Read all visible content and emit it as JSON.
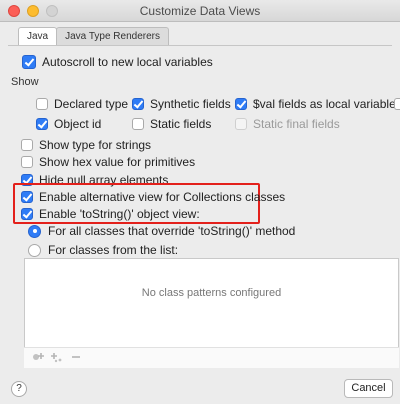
{
  "window": {
    "title": "Customize Data Views"
  },
  "tabs": [
    {
      "label": "Java",
      "active": true
    },
    {
      "label": "Java Type Renderers",
      "active": false
    }
  ],
  "autoscroll": {
    "label": "Autoscroll to new local variables",
    "checked": true
  },
  "show_section": {
    "label": "Show",
    "options": [
      {
        "label": "Declared type",
        "checked": false
      },
      {
        "label": "Synthetic fields",
        "checked": true
      },
      {
        "label": "$val fields as local variables",
        "checked": true
      },
      {
        "label": "Object id",
        "checked": true
      },
      {
        "label": "Static fields",
        "checked": false
      },
      {
        "label": "Static final fields",
        "checked": false,
        "disabled": true
      }
    ]
  },
  "options": [
    {
      "label": "Show type for strings",
      "checked": false
    },
    {
      "label": "Show hex value for primitives",
      "checked": false
    },
    {
      "label": "Hide null array elements",
      "checked": true
    },
    {
      "label": "Enable alternative view for Collections classes",
      "checked": true
    },
    {
      "label": "Enable 'toString()' object view:",
      "checked": true
    }
  ],
  "tostring_mode": {
    "options": [
      {
        "label": "For all classes that override 'toString()' method",
        "selected": true
      },
      {
        "label": "For classes from the list:",
        "selected": false
      }
    ]
  },
  "class_list": {
    "empty_text": "No class patterns configured",
    "toolbar_icons": [
      "add-class-icon",
      "add-pattern-icon",
      "remove-icon"
    ]
  },
  "footer": {
    "help_label": "?",
    "cancel_label": "Cancel"
  },
  "colors": {
    "accent": "#2f7cf6",
    "highlight": "#e3201b"
  }
}
